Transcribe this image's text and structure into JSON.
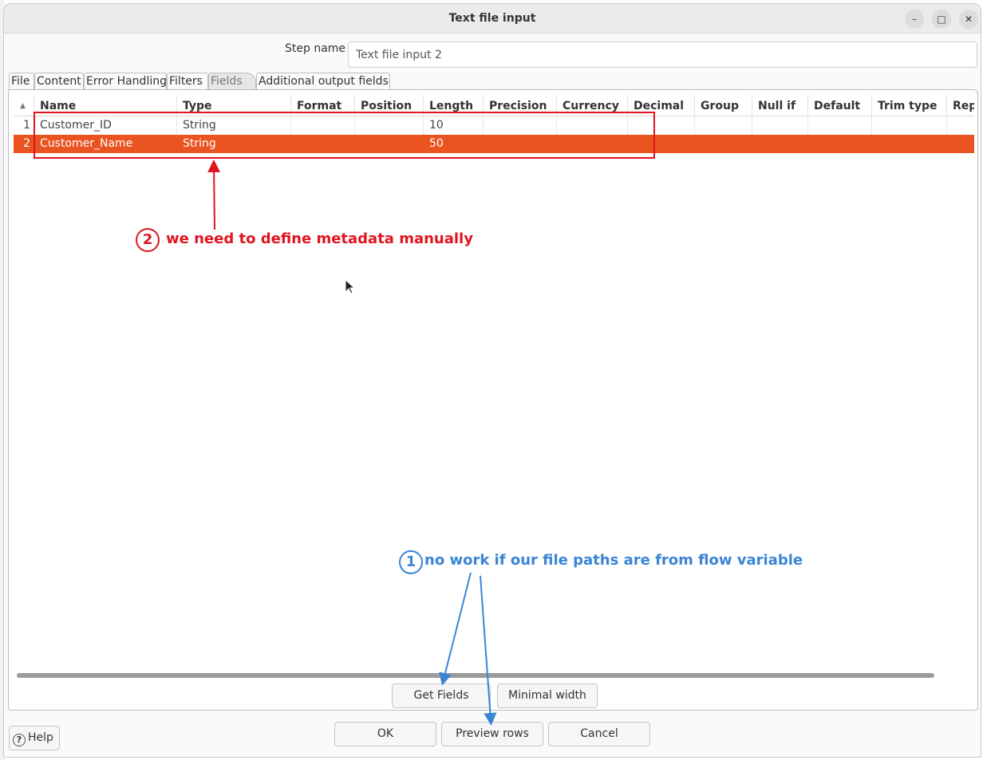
{
  "window": {
    "title": "Text file input",
    "minimize_glyph": "–",
    "maximize_glyph": "□",
    "close_glyph": "✕"
  },
  "step": {
    "label": "Step name",
    "value": "Text file input 2"
  },
  "tabs": [
    {
      "label": "File",
      "active": false
    },
    {
      "label": "Content",
      "active": false
    },
    {
      "label": "Error Handling",
      "active": false
    },
    {
      "label": "Filters",
      "active": false
    },
    {
      "label": "Fields",
      "active": true
    },
    {
      "label": "Additional output fields",
      "active": false
    }
  ],
  "table": {
    "sort_indicator": "▲",
    "columns": [
      "Name",
      "Type",
      "Format",
      "Position",
      "Length",
      "Precision",
      "Currency",
      "Decimal",
      "Group",
      "Null if",
      "Default",
      "Trim type",
      "Rep"
    ],
    "rows": [
      {
        "num": "1",
        "cells": [
          "Customer_ID",
          "String",
          "",
          "",
          "10",
          "",
          "",
          "",
          "",
          "",
          "",
          "",
          ""
        ],
        "selected": false
      },
      {
        "num": "2",
        "cells": [
          "Customer_Name",
          "String",
          "",
          "",
          "50",
          "",
          "",
          "",
          "",
          "",
          "",
          "",
          ""
        ],
        "selected": true
      }
    ]
  },
  "buttons": {
    "get_fields": "Get Fields",
    "minimal_width": "Minimal width",
    "ok": "OK",
    "preview_rows": "Preview rows",
    "cancel": "Cancel",
    "help": "Help",
    "help_glyph": "?"
  },
  "annotations": {
    "red_number": "2",
    "red_text": "we need to define metadata manually",
    "blue_number": "1",
    "blue_text": "no work if our file paths are from flow variable"
  },
  "colors": {
    "selection": "#e95420",
    "annotation_red": "#e0141e",
    "annotation_blue": "#3a84d6"
  }
}
